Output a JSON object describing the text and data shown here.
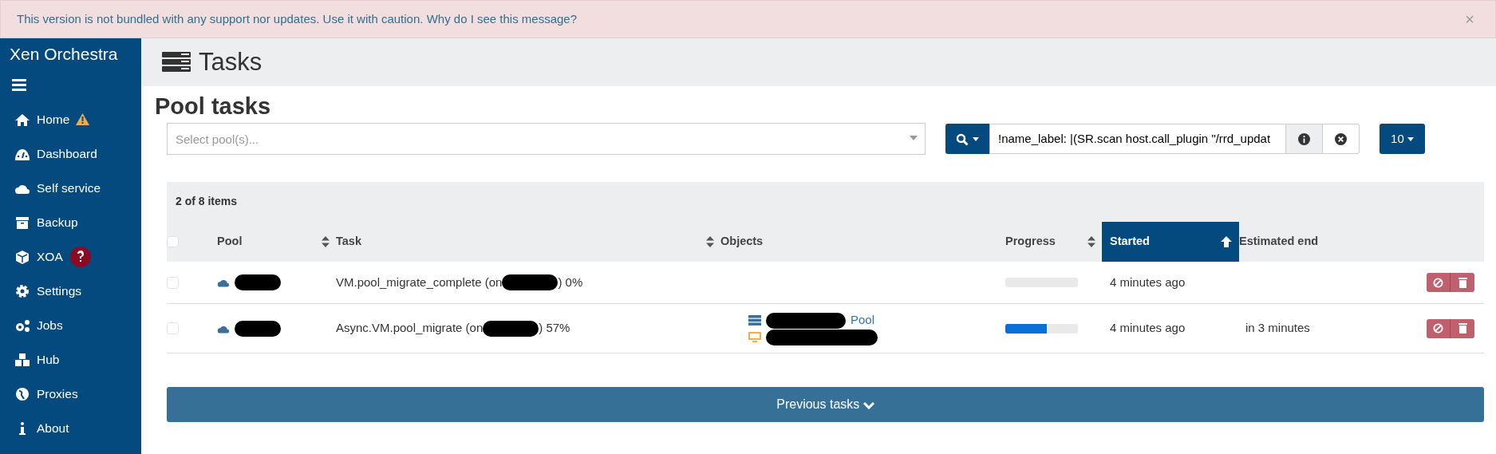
{
  "alert": {
    "text": "This version is not bundled with any support nor updates. Use it with caution.",
    "link": "Why do I see this message?",
    "close": "×"
  },
  "sidebar": {
    "brand": "Xen Orchestra",
    "items": [
      {
        "label": "Home",
        "warning": true,
        "help": false
      },
      {
        "label": "Dashboard",
        "warning": false,
        "help": false
      },
      {
        "label": "Self service",
        "warning": false,
        "help": false
      },
      {
        "label": "Backup",
        "warning": false,
        "help": false
      },
      {
        "label": "XOA",
        "warning": false,
        "help": true
      },
      {
        "label": "Settings",
        "warning": false,
        "help": false
      },
      {
        "label": "Jobs",
        "warning": false,
        "help": false
      },
      {
        "label": "Hub",
        "warning": false,
        "help": false
      },
      {
        "label": "Proxies",
        "warning": false,
        "help": false
      },
      {
        "label": "About",
        "warning": false,
        "help": false
      }
    ]
  },
  "page_title": "Tasks",
  "section_title": "Pool tasks",
  "pool_select": {
    "placeholder": "Select pool(s)..."
  },
  "search": {
    "value": "!name_label: |(SR.scan host.call_plugin \"/rrd_updat"
  },
  "per_page": "10",
  "table": {
    "count": "2 of 8 items",
    "select_all_checked": false,
    "columns": [
      {
        "label": "Pool",
        "sortable": true,
        "sorted": false
      },
      {
        "label": "Task",
        "sortable": true,
        "sorted": false
      },
      {
        "label": "Objects",
        "sortable": false,
        "sorted": false
      },
      {
        "label": "Progress",
        "sortable": true,
        "sorted": false
      },
      {
        "label": "Started",
        "sortable": true,
        "sorted": true
      },
      {
        "label": "Estimated end",
        "sortable": false,
        "sorted": false
      }
    ],
    "rows": [
      {
        "selected": false,
        "task_start": "VM.pool_migrate_complete (on",
        "task_end": ") 0%",
        "objects": [],
        "level": 0,
        "started": "4 minutes ago"
      },
      {
        "selected": false,
        "task_start": "Async.VM.pool_migrate (on",
        "task_end": ") 57%",
        "objects": [
          {
            "kind": "pool",
            "label": "Pool"
          },
          {
            "kind": "vm"
          }
        ],
        "level": 0.57,
        "started": "4 minutes ago",
        "estimated_end": "in 3 minutes"
      }
    ]
  },
  "previous_tasks": "Previous tasks"
}
